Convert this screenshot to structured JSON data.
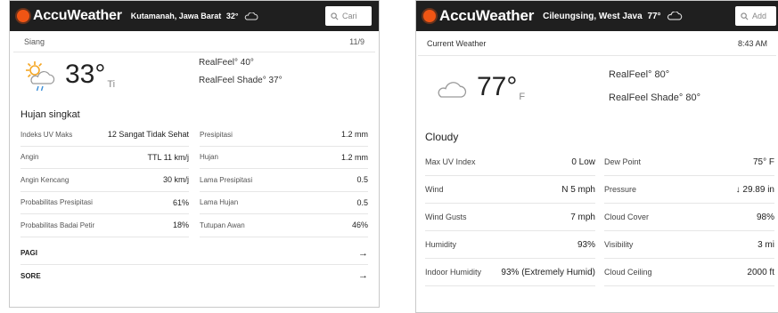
{
  "left": {
    "brand": "AccuWeather",
    "location": "Kutamanah, Jawa Barat",
    "header_temp": "32°",
    "search_placeholder": "Cari",
    "period": "Siang",
    "date": "11/9",
    "temp": "33°",
    "unit": "Ti",
    "realfeel": "RealFeel° 40°",
    "realfeel_shade": "RealFeel Shade° 37°",
    "condition": "Hujan singkat",
    "details": [
      {
        "label": "Indeks UV Maks",
        "value": "12 Sangat Tidak Sehat"
      },
      {
        "label": "Presipitasi",
        "value": "1.2 mm"
      },
      {
        "label": "Angin",
        "value": "TTL 11 km/j"
      },
      {
        "label": "Hujan",
        "value": "1.2 mm"
      },
      {
        "label": "Angin Kencang",
        "value": "30 km/j"
      },
      {
        "label": "Lama Presipitasi",
        "value": "0.5"
      },
      {
        "label": "Probabilitas Presipitasi",
        "value": "61%"
      },
      {
        "label": "Lama Hujan",
        "value": "0.5"
      },
      {
        "label": "Probabilitas Badai Petir",
        "value": "18%"
      },
      {
        "label": "Tutupan Awan",
        "value": "46%"
      }
    ],
    "links": [
      "PAGI",
      "SORE"
    ],
    "icon": "sun-cloud-rain-icon"
  },
  "right": {
    "brand": "AccuWeather",
    "location": "Cileungsing, West Java",
    "header_temp": "77°",
    "search_placeholder": "Add",
    "period": "Current Weather",
    "time": "8:43 AM",
    "temp": "77°",
    "unit": "F",
    "realfeel": "RealFeel° 80°",
    "realfeel_shade": "RealFeel Shade° 80°",
    "condition": "Cloudy",
    "details": [
      {
        "label": "Max UV Index",
        "value": "0 Low"
      },
      {
        "label": "Dew Point",
        "value": "75° F"
      },
      {
        "label": "Wind",
        "value": "N 5 mph"
      },
      {
        "label": "Pressure",
        "value": "↓ 29.89 in"
      },
      {
        "label": "Wind Gusts",
        "value": "7 mph"
      },
      {
        "label": "Cloud Cover",
        "value": "98%"
      },
      {
        "label": "Humidity",
        "value": "93%"
      },
      {
        "label": "Visibility",
        "value": "3 mi"
      },
      {
        "label": "Indoor Humidity",
        "value": "93% (Extremely Humid)"
      },
      {
        "label": "Cloud Ceiling",
        "value": "2000 ft"
      }
    ],
    "icon": "cloud-icon"
  },
  "colors": {
    "brand_orange": "#f05514",
    "topbar": "#1f1f1f"
  }
}
